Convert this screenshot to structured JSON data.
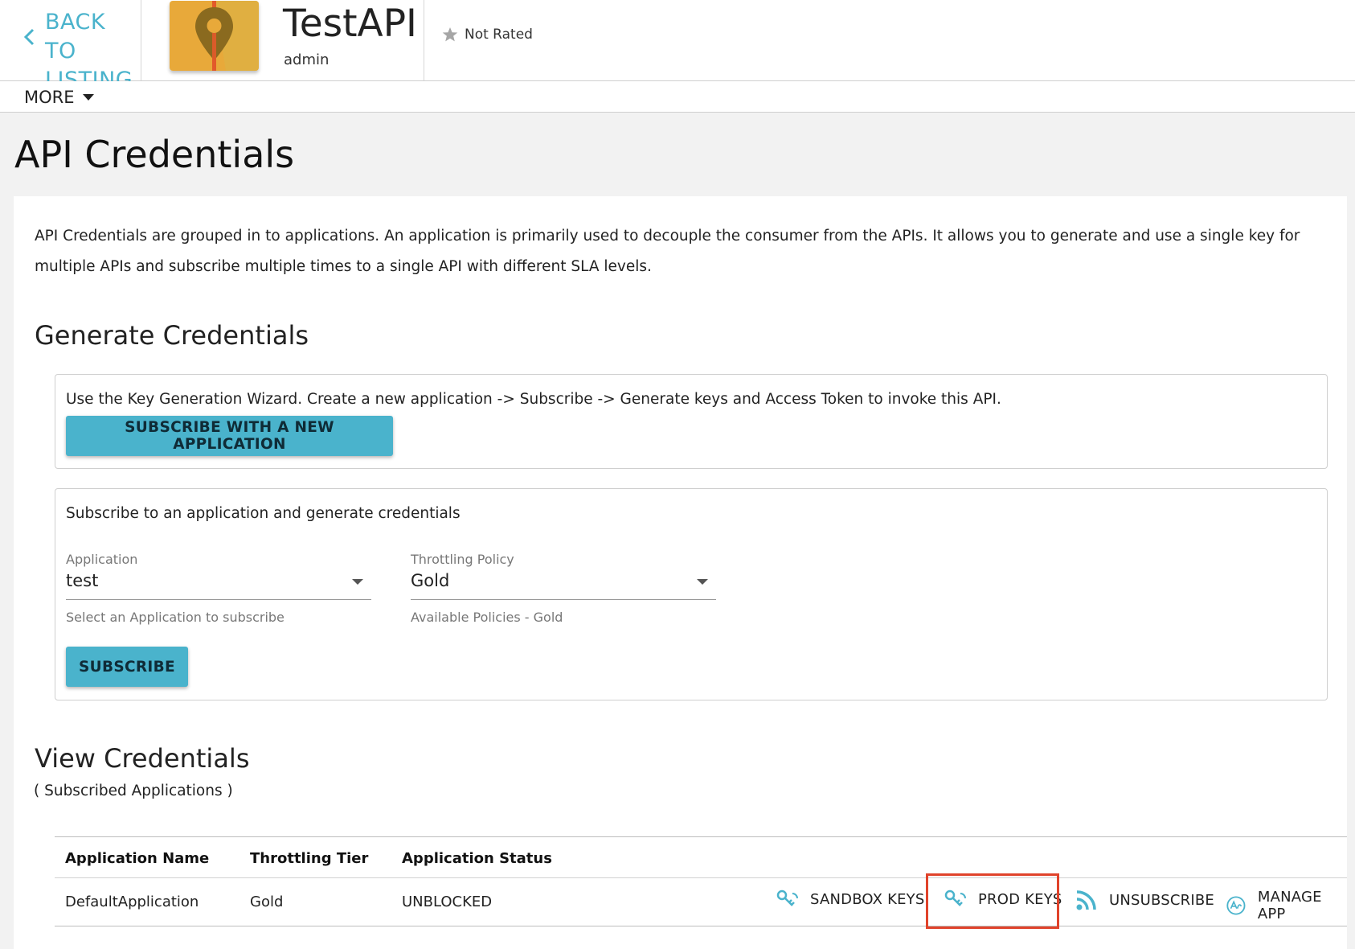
{
  "header": {
    "back_line1": "BACK TO",
    "back_line2": "LISTING",
    "api_title": "TestAPI",
    "api_owner": "admin",
    "rating_text": "Not Rated",
    "more_label": "MORE"
  },
  "page": {
    "title": "API Credentials",
    "intro": "API Credentials are grouped in to applications. An application is primarily used to decouple the consumer from the APIs. It allows you to generate and use a single key for multiple APIs and subscribe multiple times to a single API with different SLA levels."
  },
  "generate": {
    "title": "Generate Credentials",
    "wizard_text": "Use the Key Generation Wizard. Create a new application -> Subscribe -> Generate keys and Access Token to invoke this API.",
    "wizard_button": "SUBSCRIBE WITH A NEW APPLICATION",
    "subscribe_text": "Subscribe to an application and generate credentials",
    "application_label": "Application",
    "application_value": "test",
    "application_helper": "Select an Application to subscribe",
    "policy_label": "Throttling Policy",
    "policy_value": "Gold",
    "policy_helper": "Available Policies - Gold",
    "subscribe_button": "SUBSCRIBE"
  },
  "view": {
    "title": "View Credentials",
    "subtitle": "( Subscribed Applications )",
    "columns": [
      "Application Name",
      "Throttling Tier",
      "Application Status"
    ],
    "rows": [
      {
        "name": "DefaultApplication",
        "tier": "Gold",
        "status": "UNBLOCKED",
        "actions": [
          "SANDBOX KEYS",
          "PROD KEYS",
          "UNSUBSCRIBE",
          "MANAGE APP"
        ]
      }
    ]
  },
  "colors": {
    "accent": "#4ab3cc",
    "highlight": "#e0432b",
    "logo_bg": "#e8a93a"
  },
  "icons": {
    "back": "chevron-left-icon",
    "rating": "star-icon",
    "more": "caret-down-icon",
    "sandbox": "key-icon",
    "prod": "key-icon",
    "unsubscribe": "rss-feed-icon",
    "manage": "api-icon"
  }
}
